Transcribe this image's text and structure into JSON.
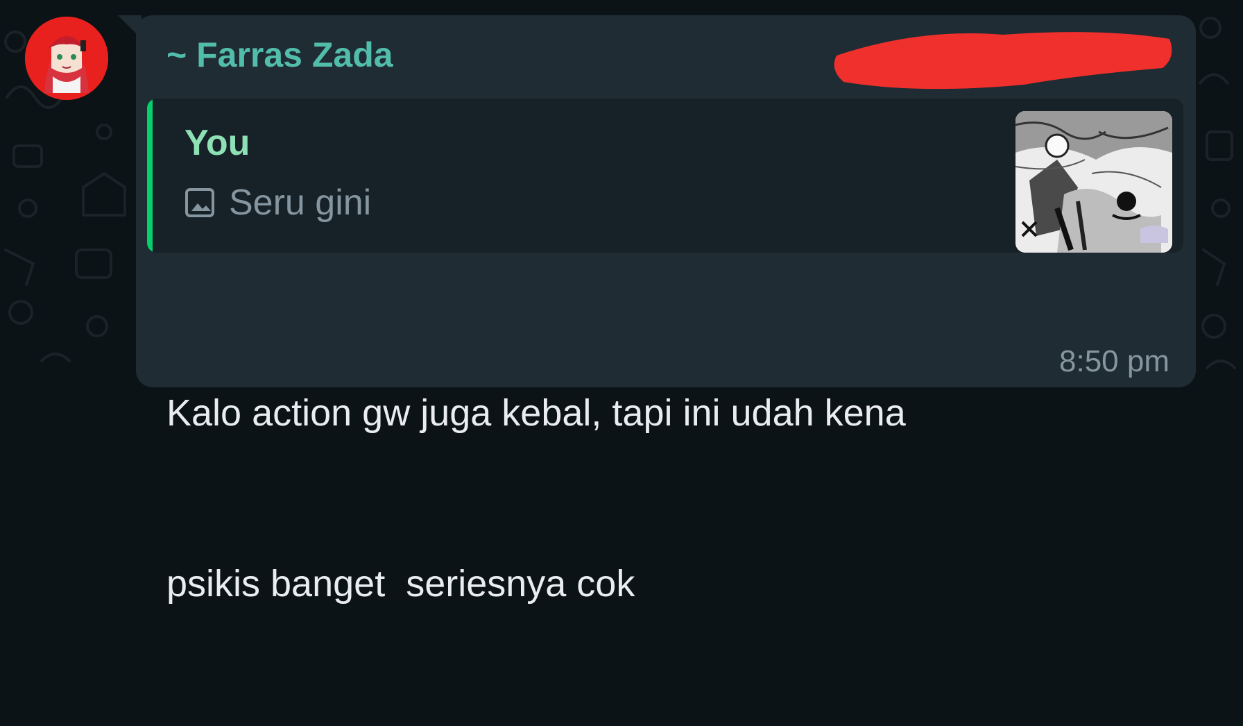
{
  "chat": {
    "sender_name": "~ Farras Zada",
    "reply": {
      "author": "You",
      "media_icon": "photo-icon",
      "caption": "Seru gini"
    },
    "message_lines": [
      "Kalo action gw juga kebal, tapi ini udah kena",
      "psikis banget  seriesnya cok"
    ],
    "timestamp": "8:50 pm"
  },
  "colors": {
    "background": "#0c1317",
    "bubble": "#1f2c34",
    "quote_background": "#172128",
    "quote_bar": "#06cf6b",
    "sender_name": "#53bdac",
    "quote_author": "#8ee1b5",
    "message_text": "#e9edef",
    "meta_text": "#8696a0",
    "avatar_background": "#e8201e",
    "redaction": "#f0302c"
  }
}
